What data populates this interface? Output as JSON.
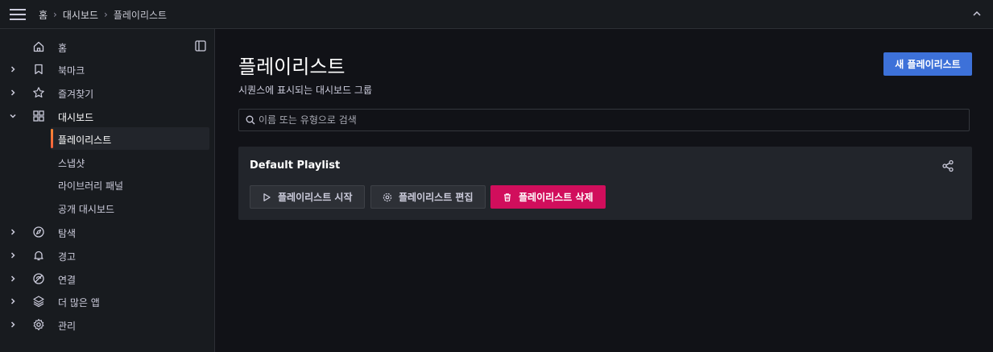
{
  "breadcrumb": {
    "home": "홈",
    "dashboards": "대시보드",
    "current": "플레이리스트"
  },
  "sidebar": {
    "items": [
      {
        "label": "홈",
        "icon": "home-icon"
      },
      {
        "label": "북마크",
        "icon": "bookmark-icon"
      },
      {
        "label": "즐겨찾기",
        "icon": "star-icon"
      },
      {
        "label": "대시보드",
        "icon": "apps-icon"
      },
      {
        "label": "탐색",
        "icon": "compass-icon"
      },
      {
        "label": "경고",
        "icon": "bell-icon"
      },
      {
        "label": "연결",
        "icon": "link-icon"
      },
      {
        "label": "더 많은 앱",
        "icon": "layers-icon"
      },
      {
        "label": "관리",
        "icon": "cog-icon"
      }
    ],
    "subitems": [
      {
        "label": "플레이리스트",
        "active": true
      },
      {
        "label": "스냅샷"
      },
      {
        "label": "라이브러리 패널"
      },
      {
        "label": "공개 대시보드"
      }
    ]
  },
  "page": {
    "title": "플레이리스트",
    "subtitle": "시퀀스에 표시되는 대시보드 그룹",
    "new_button": "새 플레이리스트",
    "search_placeholder": "이름 또는 유형으로 검색"
  },
  "playlist": {
    "name": "Default Playlist",
    "start_button": "플레이리스트 시작",
    "edit_button": "플레이리스트 편집",
    "delete_button": "플레이리스트 삭제"
  },
  "colors": {
    "primary": "#3d71d9",
    "danger": "#d10e5c",
    "accent": "#ff8833"
  }
}
